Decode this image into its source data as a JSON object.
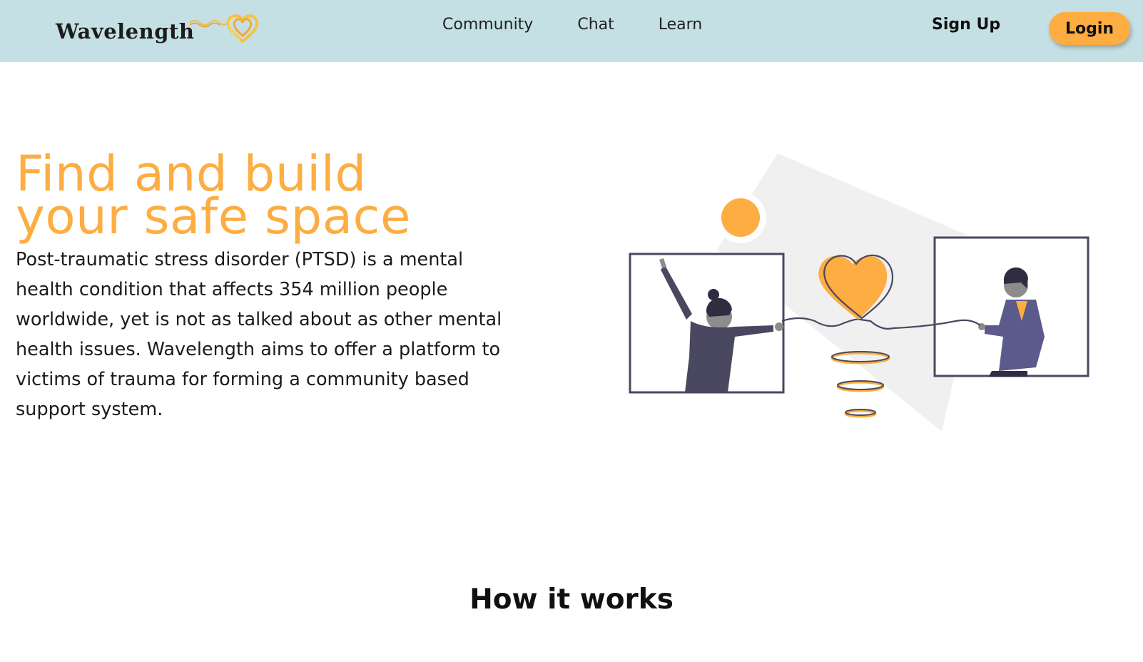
{
  "brand": {
    "name": "Wavelength",
    "logo_icon": "double-heart-icon",
    "accent_color": "#fdad41",
    "nav_background": "#c4e0e4"
  },
  "nav": {
    "links": [
      "Community",
      "Chat",
      "Learn"
    ],
    "signup_label": "Sign Up",
    "login_label": "Login"
  },
  "hero": {
    "title_line1": "Find and build",
    "title_line2": "your safe space",
    "description": "Post-traumatic stress disorder (PTSD) is a mental health condition that affects 354 million people worldwide, yet is not as talked about as other mental health issues. Wavelength aims to offer a platform to victims of trauma for forming a community based support system.",
    "illustration": "two-people-connected-by-heart-illustration"
  },
  "how_it_works": {
    "title": "How it works"
  }
}
